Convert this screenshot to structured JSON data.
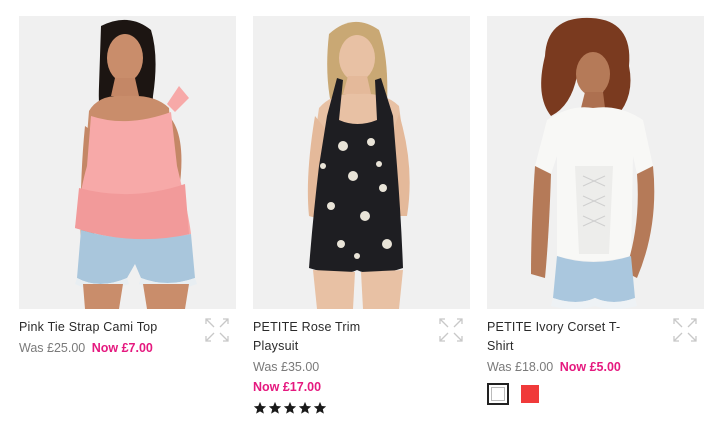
{
  "products": [
    {
      "title": "Pink Tie Strap Cami Top",
      "was": "Was £25.00",
      "now": "Now £7.00"
    },
    {
      "title": "PETITE Rose Trim Playsuit",
      "was": "Was £35.00",
      "now": "Now £17.00",
      "rating": 5
    },
    {
      "title": "PETITE Ivory Corset T-Shirt",
      "was": "Was £18.00",
      "now": "Now £5.00",
      "swatches": [
        "#ffffff",
        "#f03a3a"
      ]
    }
  ],
  "colors": {
    "sale_price": "#e5197f",
    "text": "#2a2a2a",
    "muted": "#7a7a7a"
  },
  "icons": {
    "quick_view": "expand-arrows-icon",
    "rating": "star-icon"
  }
}
